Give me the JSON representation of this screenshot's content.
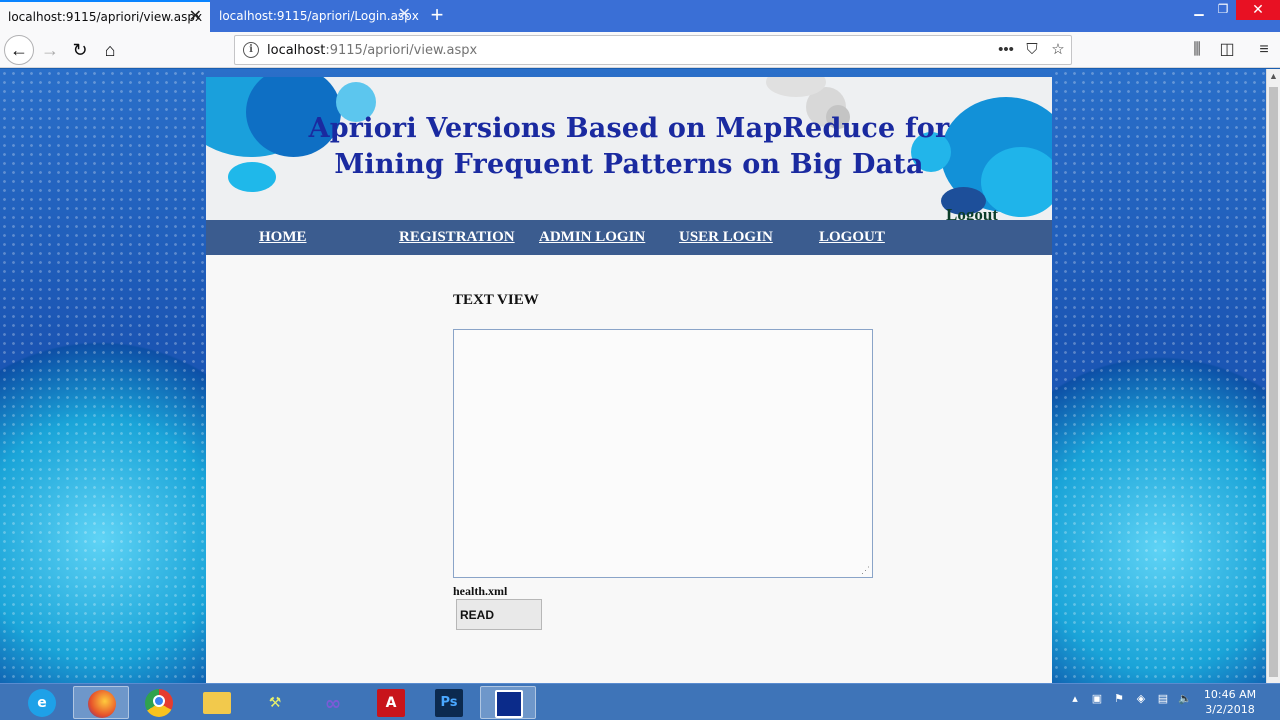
{
  "browser": {
    "tabs": [
      {
        "title": "localhost:9115/apriori/view.aspx",
        "active": true
      },
      {
        "title": "localhost:9115/apriori/Login.aspx",
        "active": false
      }
    ],
    "url_host": "localhost",
    "url_rest": ":9115/apriori/view.aspx",
    "new_tab_glyph": "+",
    "close_glyph": "✕"
  },
  "banner": {
    "title_line1": "Apriori Versions Based on MapReduce for",
    "title_line2": "Mining Frequent Patterns on Big Data",
    "logout_link": "Logout",
    "title_color": "#1a2aa0"
  },
  "menu": {
    "items": [
      {
        "label": "HOME"
      },
      {
        "label": "REGISTRATION"
      },
      {
        "label": "ADMIN LOGIN"
      },
      {
        "label": "USER LOGIN"
      },
      {
        "label": "LOGOUT"
      }
    ],
    "bar_color": "#3b5c8f"
  },
  "content": {
    "section_title": "TEXT VIEW",
    "textarea_value": "",
    "file_label": "health.xml",
    "read_button": "READ"
  },
  "taskbar": {
    "apps": [
      {
        "name": "internet-explorer-icon"
      },
      {
        "name": "firefox-icon",
        "active": true
      },
      {
        "name": "chrome-icon"
      },
      {
        "name": "file-explorer-icon"
      },
      {
        "name": "network-tool-icon"
      },
      {
        "name": "visual-studio-icon"
      },
      {
        "name": "acrobat-icon"
      },
      {
        "name": "photoshop-icon"
      },
      {
        "name": "remote-desktop-icon"
      }
    ],
    "time": "10:46 AM",
    "date": "3/2/2018"
  }
}
